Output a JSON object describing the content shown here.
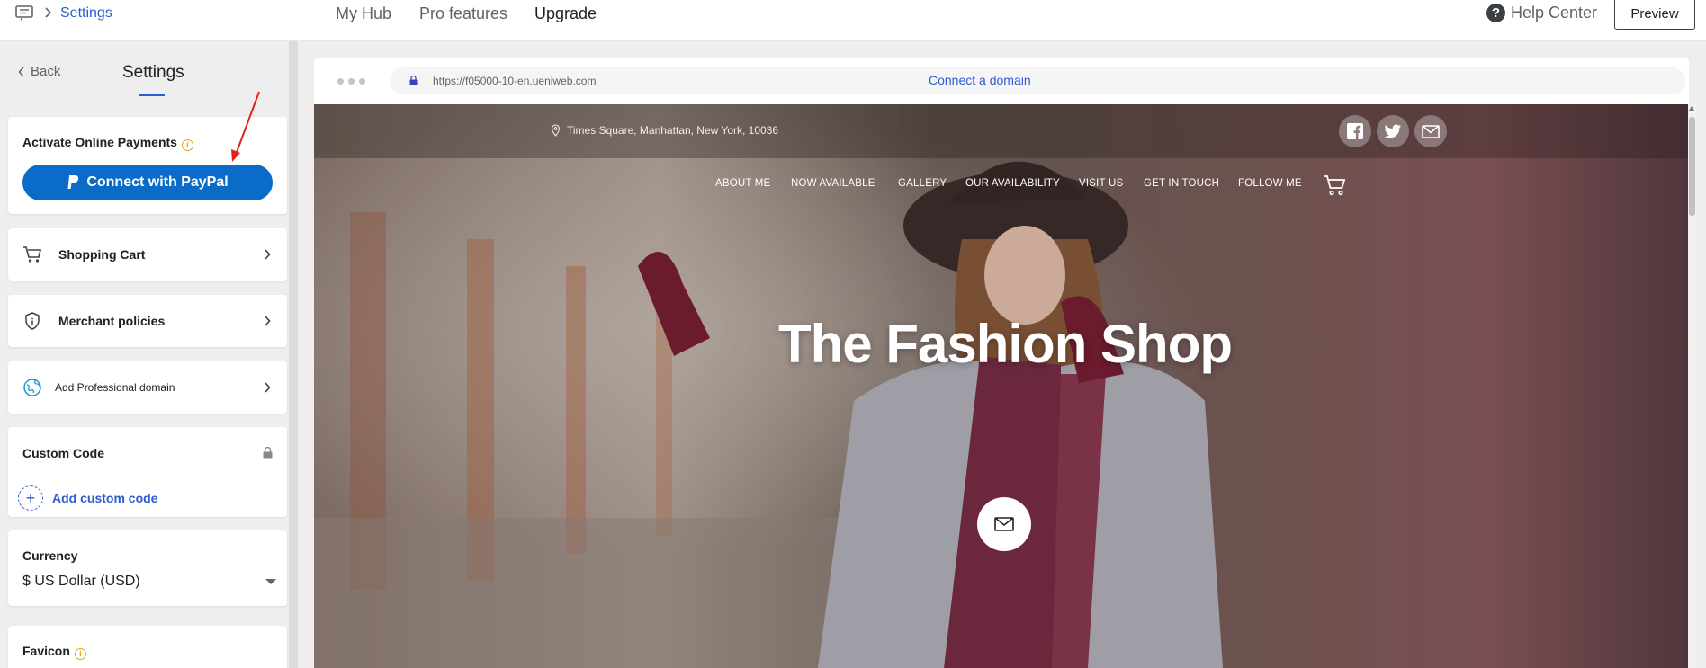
{
  "topbar": {
    "breadcrumb": "Settings",
    "nav": [
      "My Hub",
      "Pro features",
      "Upgrade"
    ],
    "help_label": "Help Center",
    "preview_label": "Preview"
  },
  "sidebar": {
    "back_label": "Back",
    "title": "Settings",
    "payments": {
      "title": "Activate Online Payments",
      "paypal_label": "Connect with PayPal"
    },
    "items": [
      {
        "label": "Shopping Cart",
        "icon": "cart-icon"
      },
      {
        "label": "Merchant policies",
        "icon": "shield-icon"
      },
      {
        "label": "Add Professional domain",
        "icon": "globe-icon"
      }
    ],
    "custom_code": {
      "title": "Custom Code",
      "add_label": "Add custom code"
    },
    "currency": {
      "title": "Currency",
      "value": "$ US Dollar (USD)"
    },
    "favicon": {
      "title": "Favicon"
    }
  },
  "preview": {
    "url": "https://f05000-10-en.ueniweb.com",
    "connect_domain": "Connect a domain",
    "site": {
      "address": "Times Square, Manhattan, New York, 10036",
      "nav": [
        "ABOUT ME",
        "NOW AVAILABLE",
        "GALLERY",
        "OUR AVAILABILITY",
        "VISIT US",
        "GET IN TOUCH",
        "FOLLOW ME"
      ],
      "hero_title": "The Fashion Shop",
      "social": [
        "facebook-icon",
        "twitter-icon",
        "mail-icon"
      ]
    }
  },
  "colors": {
    "accent": "#2d5bd1",
    "paypal": "#0b6bc8",
    "warning": "#e8a30f",
    "annotation": "#e32020"
  }
}
